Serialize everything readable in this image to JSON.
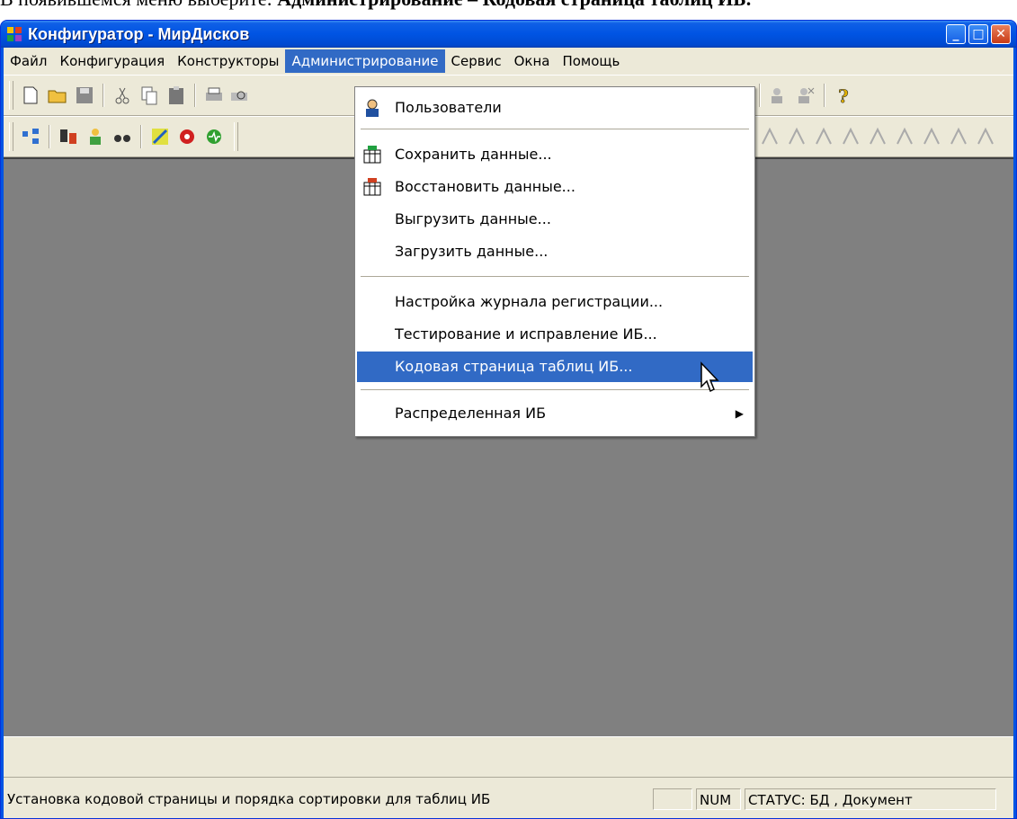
{
  "caption": {
    "prefix": "В появившемся меню выберите: ",
    "bold": "Администрирование – Кодовая страница таблиц ИБ."
  },
  "window": {
    "title": "Конфигуратор - МирДисков",
    "buttons": {
      "minimize": "_",
      "maximize": "□",
      "close": "✕"
    }
  },
  "menubar": {
    "items": [
      {
        "label": "Файл"
      },
      {
        "label": "Конфигурация"
      },
      {
        "label": "Конструкторы"
      },
      {
        "label": "Администрирование",
        "active": true
      },
      {
        "label": "Сервис"
      },
      {
        "label": "Окна"
      },
      {
        "label": "Помощь"
      }
    ]
  },
  "dropdown": {
    "items": [
      {
        "label": "Пользователи",
        "icon": "users-icon"
      },
      {
        "label": "Сохранить данные...",
        "icon": "save-data-icon"
      },
      {
        "label": "Восстановить данные...",
        "icon": "restore-data-icon"
      },
      {
        "label": "Выгрузить данные..."
      },
      {
        "label": "Загрузить данные..."
      },
      {
        "label": "Настройка журнала регистрации..."
      },
      {
        "label": "Тестирование и исправление ИБ..."
      },
      {
        "label": "Кодовая страница таблиц ИБ...",
        "highlighted": true
      },
      {
        "label": "Распределенная ИБ",
        "submenu": true
      }
    ]
  },
  "statusbar": {
    "message": "Установка кодовой страницы и порядка сортировки для таблиц ИБ",
    "num": "NUM",
    "status": "СТАТУС: БД , Документ"
  },
  "colors": {
    "titlebar": "#0054e3",
    "menu_highlight": "#316ac5",
    "mdi_background": "#808080",
    "chrome": "#ece9d8"
  }
}
